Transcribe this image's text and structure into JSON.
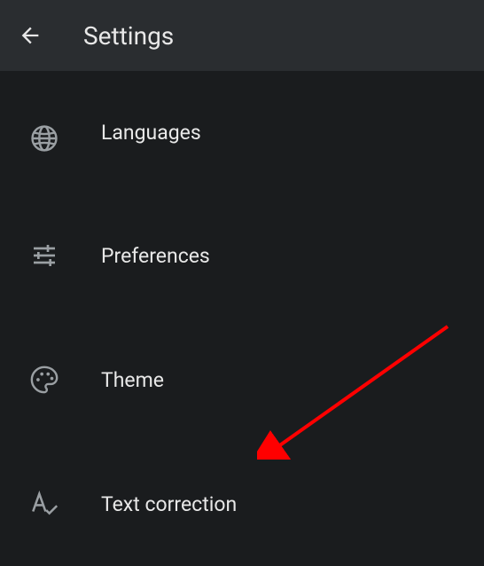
{
  "header": {
    "title": "Settings"
  },
  "items": [
    {
      "label": "Languages"
    },
    {
      "label": "Preferences"
    },
    {
      "label": "Theme"
    },
    {
      "label": "Text correction"
    }
  ]
}
